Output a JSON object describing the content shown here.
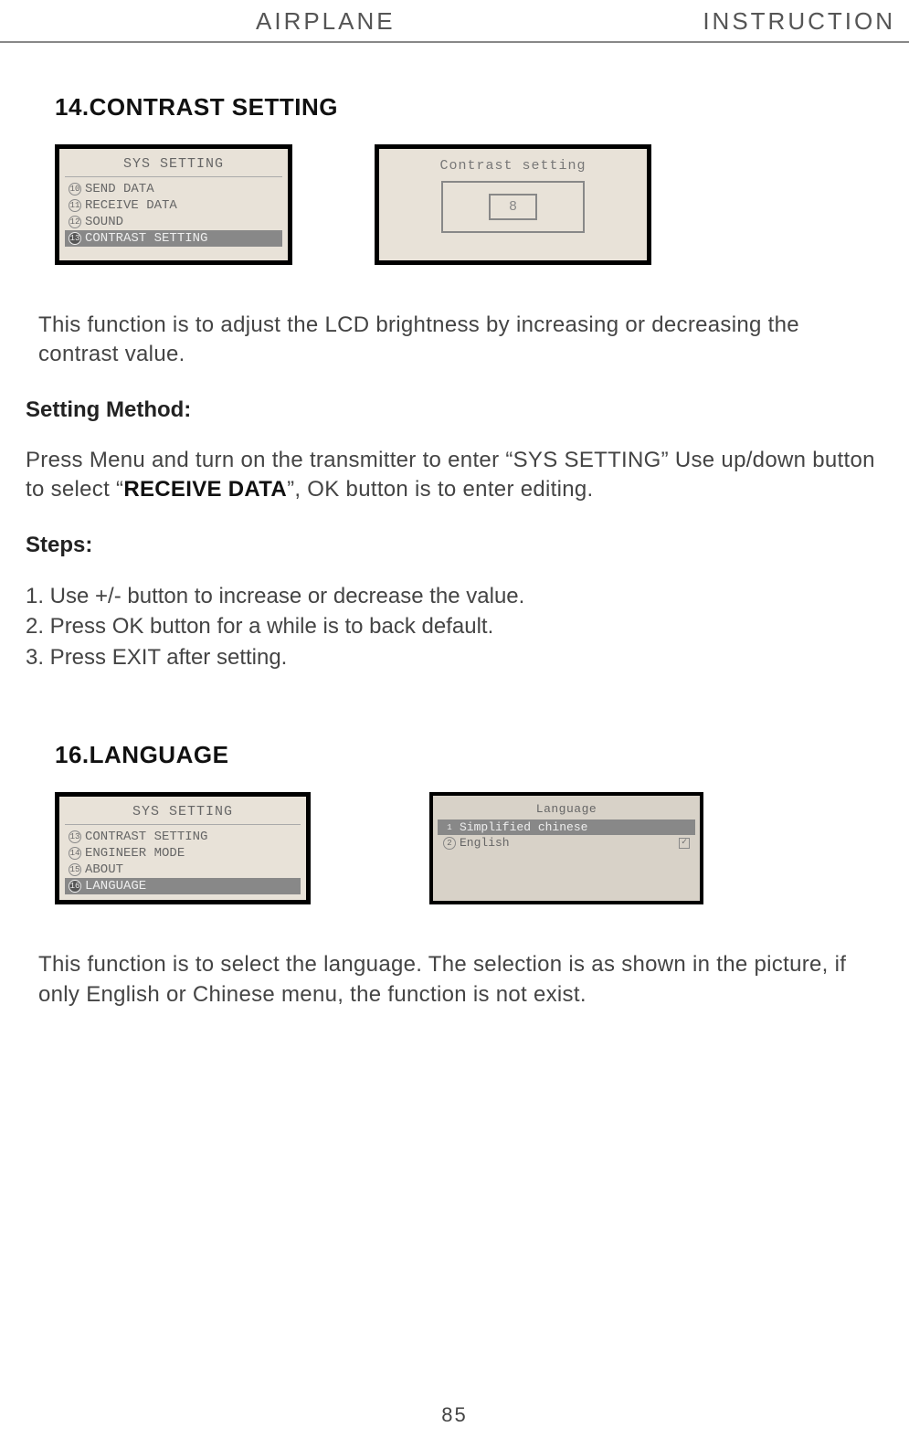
{
  "header": {
    "left": "AIRPLANE",
    "right": "INSTRUCTION"
  },
  "section14": {
    "title": "14.CONTRAST SETTING",
    "sys_lcd": {
      "title": "SYS SETTING",
      "items": [
        {
          "num": "10",
          "label": "SEND DATA"
        },
        {
          "num": "11",
          "label": "RECEIVE DATA"
        },
        {
          "num": "12",
          "label": "SOUND"
        },
        {
          "num": "13",
          "label": "CONTRAST SETTING"
        }
      ]
    },
    "contrast_lcd": {
      "title": "Contrast setting",
      "value": "8"
    },
    "intro": "This function is to adjust the LCD brightness by increasing or decreasing the contrast value.",
    "setting_method_label": "Setting Method:",
    "setting_method_text_pre": "Press Menu and turn on the transmitter to enter “SYS SETTING” Use up/down button to select “",
    "setting_method_bold": "RECEIVE DATA",
    "setting_method_text_post": "”, OK button is to enter editing.",
    "steps_label": "Steps:",
    "steps": [
      "1. Use +/- button to increase or decrease the value.",
      "2. Press OK button for a while is to back default.",
      "3. Press EXIT after setting."
    ]
  },
  "section16": {
    "title": "16.LANGUAGE",
    "sys_lcd": {
      "title": "SYS SETTING",
      "items": [
        {
          "num": "13",
          "label": "CONTRAST SETTING"
        },
        {
          "num": "14",
          "label": "ENGINEER MODE"
        },
        {
          "num": "15",
          "label": "ABOUT"
        },
        {
          "num": "16",
          "label": "LANGUAGE"
        }
      ]
    },
    "lang_lcd": {
      "title": "Language",
      "items": [
        {
          "num": "1",
          "label": "Simplified chinese",
          "selected": true
        },
        {
          "num": "2",
          "label": "English",
          "checked": true
        }
      ]
    },
    "intro": "This function is to select the language.  The selection is  as shown in the picture, if only English or Chinese menu, the function is not exist."
  },
  "page_number": "85"
}
